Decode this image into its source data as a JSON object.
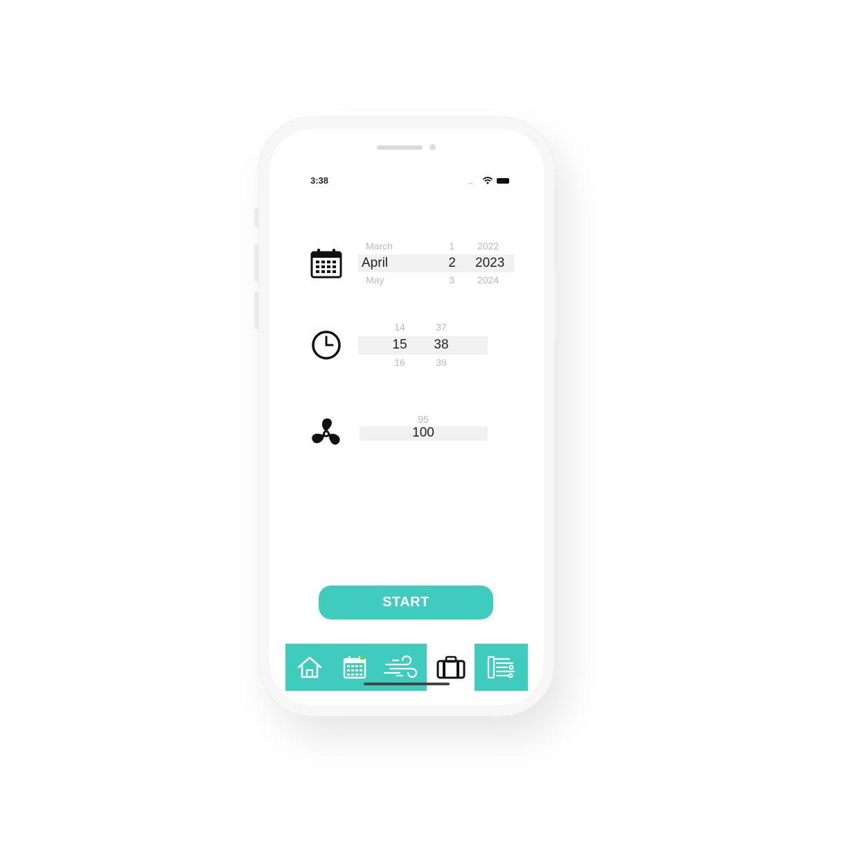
{
  "status_bar": {
    "time": "3:38",
    "signal": "....",
    "icons": [
      "wifi-icon",
      "battery-icon"
    ]
  },
  "date_picker": {
    "icon": "calendar-icon",
    "month": {
      "above": "March",
      "selected": "April",
      "below": "May"
    },
    "day": {
      "above": "1",
      "selected": "2",
      "below": "3"
    },
    "year": {
      "above": "2022",
      "selected": "2023",
      "below": "2024"
    }
  },
  "time_picker": {
    "icon": "clock-icon",
    "hour": {
      "above": "14",
      "selected": "15",
      "below": "16"
    },
    "minute": {
      "above": "37",
      "selected": "38",
      "below": "39"
    }
  },
  "fan_picker": {
    "icon": "fan-icon",
    "value": {
      "above": "95",
      "selected": "100"
    }
  },
  "start_button": {
    "label": "START"
  },
  "tab_bar": {
    "accent_color": "#40cbbf",
    "active_index": 3,
    "tabs": [
      {
        "icon": "home-icon"
      },
      {
        "icon": "calendar-icon"
      },
      {
        "icon": "wind-icon"
      },
      {
        "icon": "suitcase-icon"
      },
      {
        "icon": "settings-list-icon"
      }
    ]
  }
}
